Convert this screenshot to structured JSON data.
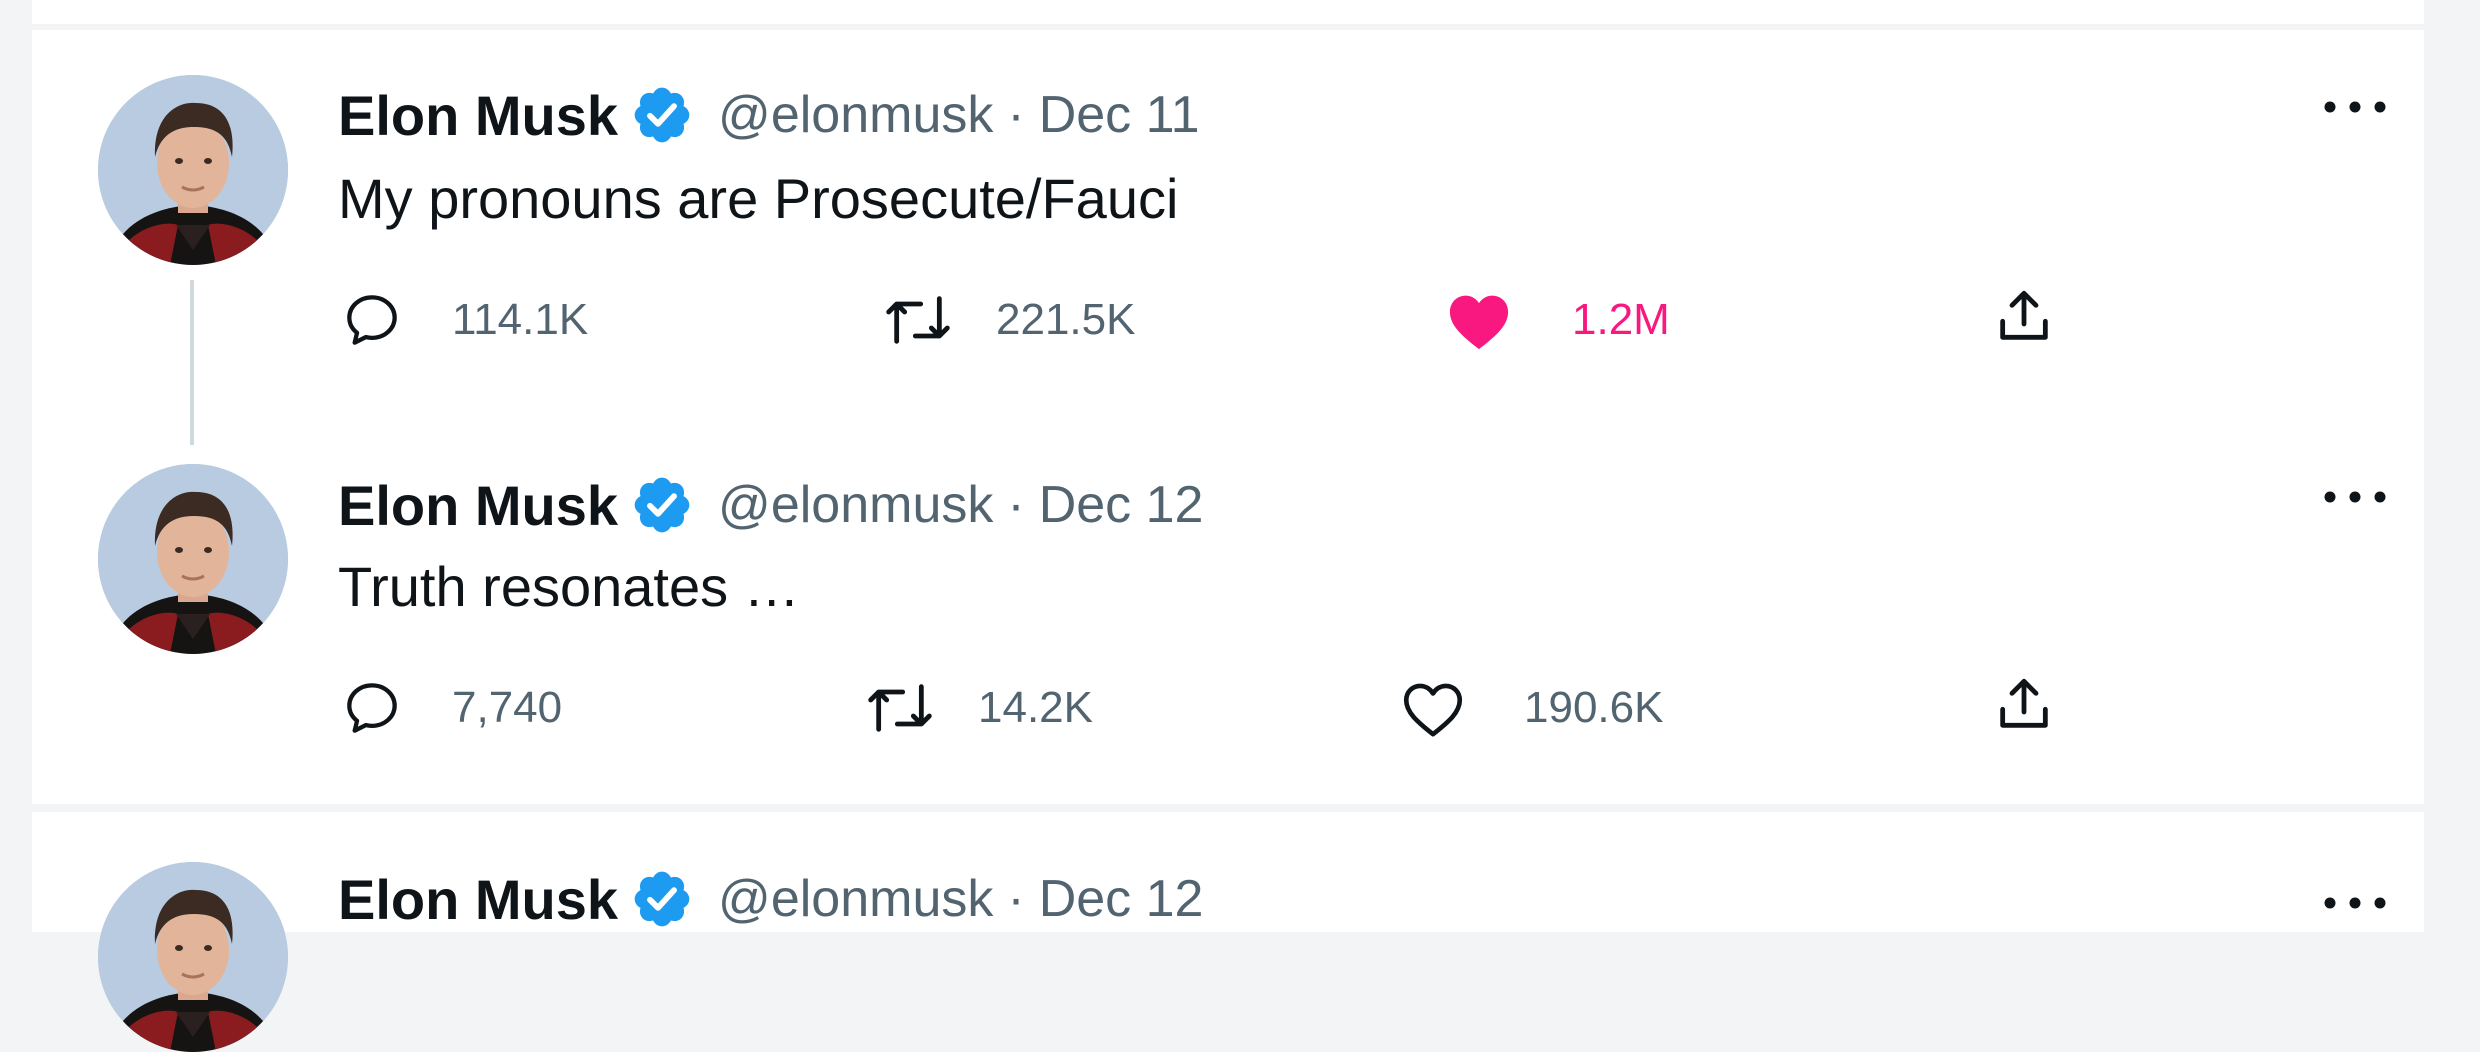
{
  "tweets": [
    {
      "author": {
        "name": "Elon Musk",
        "handle": "@elonmusk",
        "verified": true
      },
      "separator": "·",
      "date": "Dec 11",
      "text": "My pronouns are Prosecute/Fauci",
      "stats": {
        "replies": "114.1K",
        "retweets": "221.5K",
        "likes": "1.2M",
        "liked": true
      },
      "icons": [
        "reply-icon",
        "retweet-icon",
        "heart-filled-icon",
        "share-icon",
        "more-icon"
      ]
    },
    {
      "author": {
        "name": "Elon Musk",
        "handle": "@elonmusk",
        "verified": true
      },
      "separator": "·",
      "date": "Dec 12",
      "text": "Truth resonates …",
      "stats": {
        "replies": "7,740",
        "retweets": "14.2K",
        "likes": "190.6K",
        "liked": false
      },
      "icons": [
        "reply-icon",
        "retweet-icon",
        "heart-outline-icon",
        "share-icon",
        "more-icon"
      ]
    },
    {
      "author": {
        "name": "Elon Musk",
        "handle": "@elonmusk",
        "verified": true
      },
      "separator": "·",
      "date": "Dec 12"
    }
  ],
  "colors": {
    "text_primary": "#0f1419",
    "text_secondary": "#536471",
    "verified_blue": "#1d9bf0",
    "like_pink": "#f91880",
    "thread_line": "#cfd9de"
  }
}
